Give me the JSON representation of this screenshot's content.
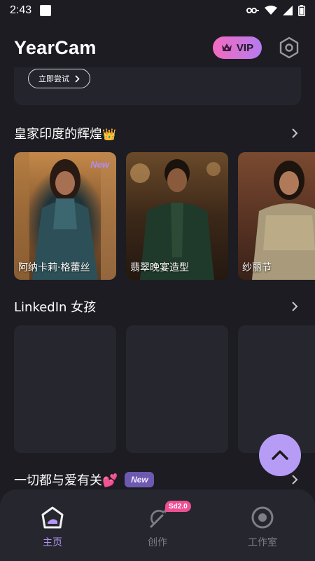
{
  "status_bar": {
    "time": "2:43"
  },
  "header": {
    "title": "YearCam",
    "vip_label": "VIP"
  },
  "banner": {
    "try_label": "立即尝试"
  },
  "sections": [
    {
      "title": "皇家印度的辉煌",
      "title_emoji": "👑",
      "cards": [
        {
          "label": "阿纳卡莉·格蕾丝",
          "tag": "New"
        },
        {
          "label": "翡翠晚宴造型",
          "tag": ""
        },
        {
          "label": "纱丽节",
          "tag": ""
        }
      ]
    },
    {
      "title": "LinkedIn 女孩"
    },
    {
      "title": "一切都与爱有关",
      "title_emoji": "💕",
      "tag": "New"
    }
  ],
  "bottom_nav": {
    "items": [
      {
        "label": "主页",
        "icon": "home-icon",
        "active": true
      },
      {
        "label": "创作",
        "icon": "magic-wand-icon",
        "badge": "Sd2.0"
      },
      {
        "label": "工作室",
        "icon": "studio-icon"
      }
    ]
  },
  "colors": {
    "accent": "#b496f6",
    "background": "#1c1c22",
    "card": "#26262e",
    "vip_gradient_start": "#f36bbf",
    "vip_gradient_end": "#b67bf0"
  }
}
